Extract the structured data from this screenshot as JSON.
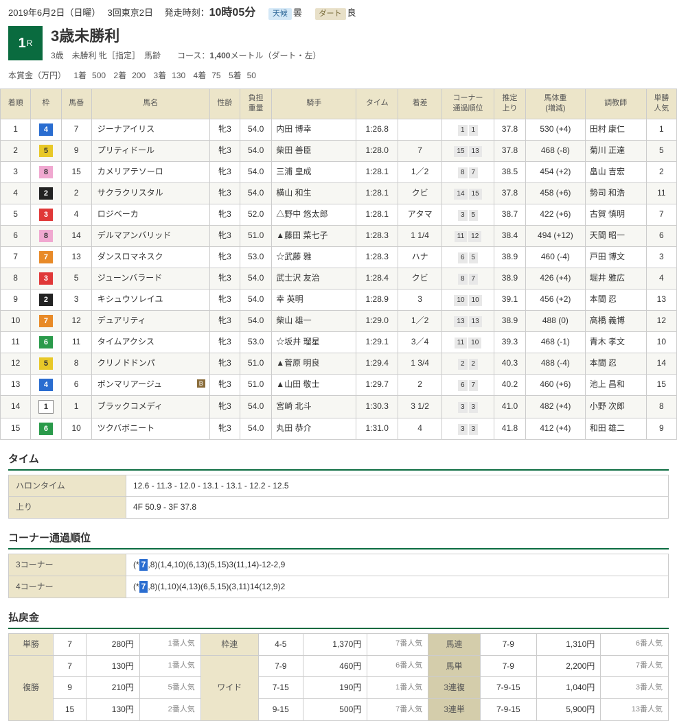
{
  "header": {
    "date": "2019年6月2日（日曜）",
    "kaisai": "3回東京2日",
    "post_label": "発走時刻：",
    "post_time": "10時05分",
    "weather_label": "天候",
    "weather_val": "曇",
    "track_label": "ダート",
    "track_val": "良"
  },
  "race": {
    "num": "1",
    "num_suffix": "R",
    "title": "3歳未勝利",
    "sub": "3歳　未勝利 牝［指定］　馬齢　　コース：",
    "dist": "1,400",
    "dist_suffix": "メートル（ダート・左）"
  },
  "prize": {
    "label": "本賞金（万円）",
    "p1_l": "1着",
    "p1": "500",
    "p2_l": "2着",
    "p2": "200",
    "p3_l": "3着",
    "p3": "130",
    "p4_l": "4着",
    "p4": "75",
    "p5_l": "5着",
    "p5": "50"
  },
  "cols": {
    "c1": "着順",
    "c2": "枠",
    "c3": "馬番",
    "c4": "馬名",
    "c5": "性齢",
    "c6": "負担\n重量",
    "c7": "騎手",
    "c8": "タイム",
    "c9": "着差",
    "c10": "コーナー\n通過順位",
    "c11": "推定\n上り",
    "c12": "馬体重\n(増減)",
    "c13": "調教師",
    "c14": "単勝\n人気"
  },
  "rows": [
    {
      "pos": "1",
      "waku": "4",
      "num": "7",
      "name": "ジーナアイリス",
      "blk": "",
      "sex": "牝3",
      "wt": "54.0",
      "jockey": "内田 博幸",
      "time": "1:26.8",
      "margin": "",
      "corner": [
        "1",
        "1"
      ],
      "agari": "37.8",
      "weight": "530 (+4)",
      "trainer": "田村 康仁",
      "pop": "1"
    },
    {
      "pos": "2",
      "waku": "5",
      "num": "9",
      "name": "プリティドール",
      "blk": "",
      "sex": "牝3",
      "wt": "54.0",
      "jockey": "柴田 善臣",
      "time": "1:28.0",
      "margin": "7",
      "corner": [
        "15",
        "13"
      ],
      "agari": "37.8",
      "weight": "468 (-8)",
      "trainer": "菊川 正達",
      "pop": "5"
    },
    {
      "pos": "3",
      "waku": "8",
      "num": "15",
      "name": "カメリアテソーロ",
      "blk": "",
      "sex": "牝3",
      "wt": "54.0",
      "jockey": "三浦 皇成",
      "time": "1:28.1",
      "margin": "1／2",
      "corner": [
        "8",
        "7"
      ],
      "agari": "38.5",
      "weight": "454 (+2)",
      "trainer": "畠山 吉宏",
      "pop": "2"
    },
    {
      "pos": "4",
      "waku": "2",
      "num": "2",
      "name": "サクラクリスタル",
      "blk": "",
      "sex": "牝3",
      "wt": "54.0",
      "jockey": "横山 和生",
      "time": "1:28.1",
      "margin": "クビ",
      "corner": [
        "14",
        "15"
      ],
      "agari": "37.8",
      "weight": "458 (+6)",
      "trainer": "勢司 和浩",
      "pop": "11"
    },
    {
      "pos": "5",
      "waku": "3",
      "num": "4",
      "name": "ロジベーカ",
      "blk": "",
      "sex": "牝3",
      "wt": "52.0",
      "jockey": "△野中 悠太郎",
      "time": "1:28.1",
      "margin": "アタマ",
      "corner": [
        "3",
        "5"
      ],
      "agari": "38.7",
      "weight": "422 (+6)",
      "trainer": "古賀 慎明",
      "pop": "7"
    },
    {
      "pos": "6",
      "waku": "8",
      "num": "14",
      "name": "デルマアンバリッド",
      "blk": "",
      "sex": "牝3",
      "wt": "51.0",
      "jockey": "▲藤田 菜七子",
      "time": "1:28.3",
      "margin": "1 1/4",
      "corner": [
        "11",
        "12"
      ],
      "agari": "38.4",
      "weight": "494 (+12)",
      "trainer": "天間 昭一",
      "pop": "6"
    },
    {
      "pos": "7",
      "waku": "7",
      "num": "13",
      "name": "ダンスロマネスク",
      "blk": "",
      "sex": "牝3",
      "wt": "53.0",
      "jockey": "☆武藤 雅",
      "time": "1:28.3",
      "margin": "ハナ",
      "corner": [
        "6",
        "5"
      ],
      "agari": "38.9",
      "weight": "460 (-4)",
      "trainer": "戸田 博文",
      "pop": "3"
    },
    {
      "pos": "8",
      "waku": "3",
      "num": "5",
      "name": "ジューンバラード",
      "blk": "",
      "sex": "牝3",
      "wt": "54.0",
      "jockey": "武士沢 友治",
      "time": "1:28.4",
      "margin": "クビ",
      "corner": [
        "8",
        "7"
      ],
      "agari": "38.9",
      "weight": "426 (+4)",
      "trainer": "堀井 雅広",
      "pop": "4"
    },
    {
      "pos": "9",
      "waku": "2",
      "num": "3",
      "name": "キシュウソレイユ",
      "blk": "",
      "sex": "牝3",
      "wt": "54.0",
      "jockey": "幸 英明",
      "time": "1:28.9",
      "margin": "3",
      "corner": [
        "10",
        "10"
      ],
      "agari": "39.1",
      "weight": "456 (+2)",
      "trainer": "本間 忍",
      "pop": "13"
    },
    {
      "pos": "10",
      "waku": "7",
      "num": "12",
      "name": "デュアリティ",
      "blk": "",
      "sex": "牝3",
      "wt": "54.0",
      "jockey": "柴山 雄一",
      "time": "1:29.0",
      "margin": "1／2",
      "corner": [
        "13",
        "13"
      ],
      "agari": "38.9",
      "weight": "488 (0)",
      "trainer": "高橋 義博",
      "pop": "12"
    },
    {
      "pos": "11",
      "waku": "6",
      "num": "11",
      "name": "タイムアクシス",
      "blk": "",
      "sex": "牝3",
      "wt": "53.0",
      "jockey": "☆坂井 瑠星",
      "time": "1:29.1",
      "margin": "3／4",
      "corner": [
        "11",
        "10"
      ],
      "agari": "39.3",
      "weight": "468 (-1)",
      "trainer": "青木 孝文",
      "pop": "10"
    },
    {
      "pos": "12",
      "waku": "5",
      "num": "8",
      "name": "クリノドドンパ",
      "blk": "",
      "sex": "牝3",
      "wt": "51.0",
      "jockey": "▲菅原 明良",
      "time": "1:29.4",
      "margin": "1 3/4",
      "corner": [
        "2",
        "2"
      ],
      "agari": "40.3",
      "weight": "488 (-4)",
      "trainer": "本間 忍",
      "pop": "14"
    },
    {
      "pos": "13",
      "waku": "4",
      "num": "6",
      "name": "ボンマリアージュ",
      "blk": "B",
      "sex": "牝3",
      "wt": "51.0",
      "jockey": "▲山田 敬士",
      "time": "1:29.7",
      "margin": "2",
      "corner": [
        "6",
        "7"
      ],
      "agari": "40.2",
      "weight": "460 (+6)",
      "trainer": "池上 昌和",
      "pop": "15"
    },
    {
      "pos": "14",
      "waku": "1",
      "num": "1",
      "name": "ブラックコメディ",
      "blk": "",
      "sex": "牝3",
      "wt": "54.0",
      "jockey": "宮崎 北斗",
      "time": "1:30.3",
      "margin": "3 1/2",
      "corner": [
        "3",
        "3"
      ],
      "agari": "41.0",
      "weight": "482 (+4)",
      "trainer": "小野 次郎",
      "pop": "8"
    },
    {
      "pos": "15",
      "waku": "6",
      "num": "10",
      "name": "ツクバボニート",
      "blk": "",
      "sex": "牝3",
      "wt": "54.0",
      "jockey": "丸田 恭介",
      "time": "1:31.0",
      "margin": "4",
      "corner": [
        "3",
        "3"
      ],
      "agari": "41.8",
      "weight": "412 (+4)",
      "trainer": "和田 雄二",
      "pop": "9"
    }
  ],
  "sections": {
    "time": "タイム",
    "corner": "コーナー通過順位",
    "payout": "払戻金"
  },
  "time_tbl": {
    "halon_l": "ハロンタイム",
    "halon": "12.6 - 11.3 - 12.0 - 13.1 - 13.1 - 12.2 - 12.5",
    "agari_l": "上り",
    "agari": "4F 50.9 - 3F 37.8"
  },
  "corner_tbl": {
    "c3_l": "3コーナー",
    "c3_pre": "(*",
    "c3_em": "7",
    "c3_post": ",8)(1,4,10)(6,13)(5,15)3(11,14)-12-2,9",
    "c4_l": "4コーナー",
    "c4_pre": "(*",
    "c4_em": "7",
    "c4_post": ",8)(1,10)(4,13)(6,5,15)(3,11)14(12,9)2"
  },
  "payout": {
    "tansho_l": "単勝",
    "fukusho_l": "複勝",
    "wakuren_l": "枠連",
    "wide_l": "ワイド",
    "umaren_l": "馬連",
    "umatan_l": "馬単",
    "sanpuku_l": "3連複",
    "santan_l": "3連単",
    "tansho": {
      "n": "7",
      "y": "280円",
      "p": "1番人気"
    },
    "fukusho": [
      {
        "n": "7",
        "y": "130円",
        "p": "1番人気"
      },
      {
        "n": "9",
        "y": "210円",
        "p": "5番人気"
      },
      {
        "n": "15",
        "y": "130円",
        "p": "2番人気"
      }
    ],
    "wakuren": {
      "n": "4-5",
      "y": "1,370円",
      "p": "7番人気"
    },
    "wide": [
      {
        "n": "7-9",
        "y": "460円",
        "p": "6番人気"
      },
      {
        "n": "7-15",
        "y": "190円",
        "p": "1番人気"
      },
      {
        "n": "9-15",
        "y": "500円",
        "p": "7番人気"
      }
    ],
    "umaren": {
      "n": "7-9",
      "y": "1,310円",
      "p": "6番人気"
    },
    "umatan": {
      "n": "7-9",
      "y": "2,200円",
      "p": "7番人気"
    },
    "sanpuku": {
      "n": "7-9-15",
      "y": "1,040円",
      "p": "3番人気"
    },
    "santan": {
      "n": "7-9-15",
      "y": "5,900円",
      "p": "13番人気"
    }
  }
}
